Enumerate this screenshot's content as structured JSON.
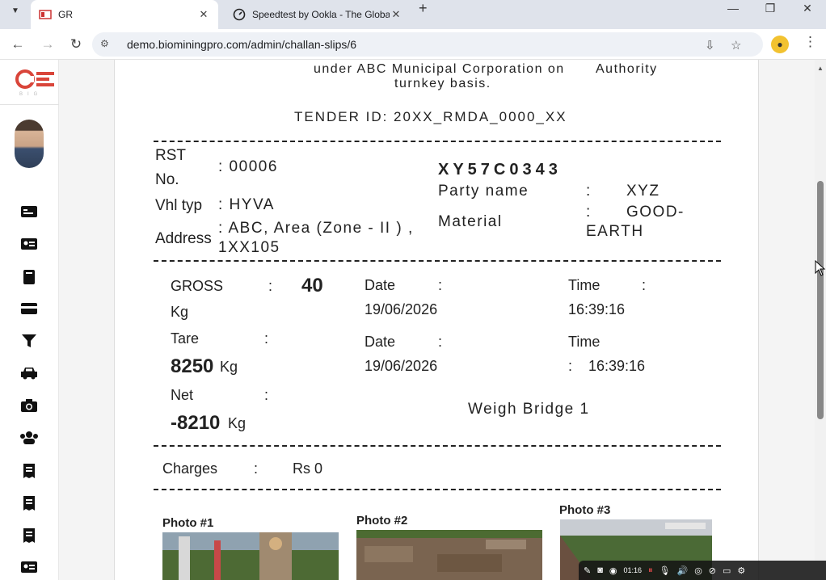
{
  "browser": {
    "tabs": [
      {
        "label": "GR",
        "active": true
      },
      {
        "label": "Speedtest by Ookla - The Globa",
        "active": false
      }
    ],
    "url": "demo.biominingpro.com/admin/challan-slips/6"
  },
  "slip": {
    "header_line1": "under ABC Municipal Corporation on",
    "header_line2": "turnkey basis.",
    "header_right": "Authority",
    "tender": "TENDER ID: 20XX_RMDA_0000_XX",
    "rst_label_1": "RST",
    "rst_label_2": "No.",
    "rst_value": ": 00006",
    "vehicle_number": "XY57C0343",
    "vehicle_type_label": "Vhl typ",
    "vehicle_type_value": ": HYVA",
    "address_label": "Address",
    "address_value_1": ": ABC, Area (Zone - II ) ,",
    "address_value_2": "1XX105",
    "party_label": "Party name",
    "party_colon": ":",
    "party_value": "XYZ",
    "material_label": "Material",
    "material_colon": ":",
    "material_value_1": "GOOD-",
    "material_value_2": "EARTH",
    "gross_label": "GROSS",
    "gross_colon": ":",
    "gross_value": "40",
    "gross_unit": "Kg",
    "gross_date_label": "Date",
    "gross_date_colon": ":",
    "gross_date": "19/06/2026",
    "gross_time_label": "Time",
    "gross_time_colon": ":",
    "gross_time": "16:39:16",
    "tare_label": "Tare",
    "tare_colon": ":",
    "tare_value": "8250",
    "tare_unit": "Kg",
    "tare_date_label": "Date",
    "tare_date_colon": ":",
    "tare_date": "19/06/2026",
    "tare_time_label": "Time",
    "tare_time": ":    16:39:16",
    "net_label": "Net",
    "net_colon": ":",
    "net_value": "-8210",
    "net_unit": "Kg",
    "weigh_bridge": "Weigh Bridge 1",
    "charges_label": "Charges",
    "charges_colon": ":",
    "charges_value": "Rs 0",
    "photos": [
      "Photo #1",
      "Photo #2",
      "Photo #3"
    ]
  },
  "recording": {
    "time": "01:16"
  },
  "sidebar_icons": [
    "dashboard-icon",
    "id-card-icon",
    "book-icon",
    "card-icon",
    "filter-icon",
    "car-icon",
    "camera-icon",
    "users-icon",
    "receipt-icon",
    "receipt-icon",
    "receipt-icon",
    "id-card-icon"
  ]
}
